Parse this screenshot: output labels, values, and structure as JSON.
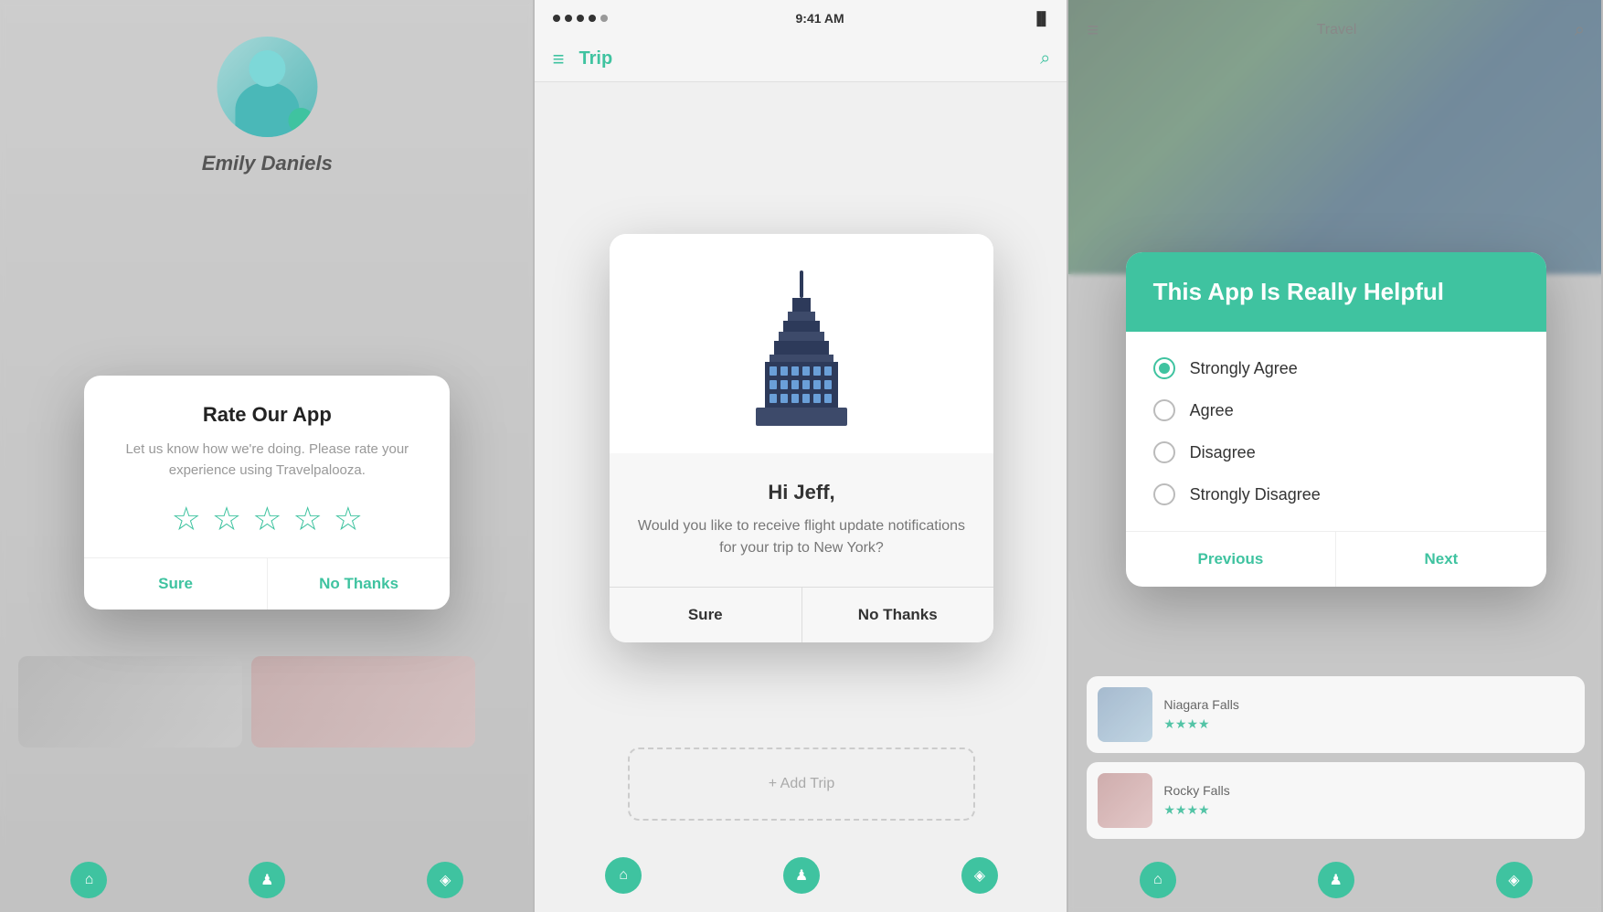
{
  "panels": {
    "left": {
      "user_name": "Emily Daniels",
      "modal": {
        "title": "Rate Our App",
        "description": "Let us know how we're doing. Please rate your experience using Travelpalooza.",
        "stars_count": 5,
        "btn_sure": "Sure",
        "btn_no_thanks": "No Thanks"
      }
    },
    "middle": {
      "status_bar": {
        "time": "9:41 AM",
        "battery": "🔋"
      },
      "nav": {
        "title": "Trip",
        "menu_icon": "≡",
        "search_icon": "🔍"
      },
      "modal": {
        "title": "Hi Jeff,",
        "description": "Would you like to receive flight update notifications for your trip to New York?",
        "btn_sure": "Sure",
        "btn_no_thanks": "No Thanks"
      },
      "add_trip_label": "+ Add Trip"
    },
    "right": {
      "modal": {
        "header_title": "This App Is Really Helpful",
        "options": [
          {
            "label": "Strongly Agree",
            "selected": true
          },
          {
            "label": "Agree",
            "selected": false
          },
          {
            "label": "Disagree",
            "selected": false
          },
          {
            "label": "Strongly Disagree",
            "selected": false
          }
        ],
        "btn_previous": "Previous",
        "btn_next": "Next"
      },
      "cards": [
        {
          "name": "Niagara Falls",
          "stars": "★★★★"
        },
        {
          "name": "Rocky Falls",
          "stars": "★★★★"
        }
      ]
    }
  },
  "accent_color": "#3fc3a0",
  "icons": {
    "hamburger": "≡",
    "search": "⌕",
    "home": "⌂",
    "person": "👤",
    "map": "🗺"
  }
}
